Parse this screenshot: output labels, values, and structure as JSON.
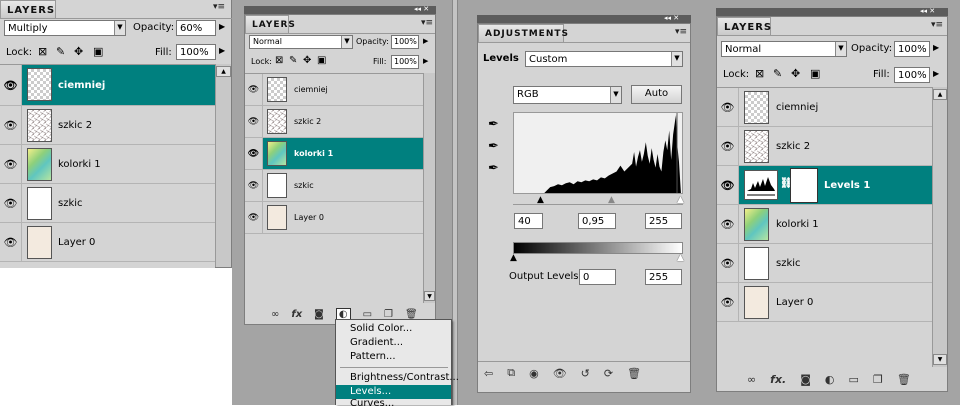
{
  "panel1": {
    "title": "LAYERS",
    "blend_mode": "Multiply",
    "opacity_label": "Opacity:",
    "opacity": "60%",
    "lock_label": "Lock:",
    "fill_label": "Fill:",
    "fill": "100%",
    "layers": [
      {
        "name": "ciemniej",
        "selected": true,
        "thumb": "checker"
      },
      {
        "name": "szkic 2",
        "selected": false,
        "thumb": "sketch"
      },
      {
        "name": "kolorki 1",
        "selected": false,
        "thumb": "color"
      },
      {
        "name": "szkic",
        "selected": false,
        "thumb": "white"
      },
      {
        "name": "Layer 0",
        "selected": false,
        "thumb": "cream"
      }
    ]
  },
  "panel2": {
    "title": "LAYERS",
    "blend_mode": "Normal",
    "opacity_label": "Opacity:",
    "opacity": "100%",
    "lock_label": "Lock:",
    "fill_label": "Fill:",
    "fill": "100%",
    "layers": [
      {
        "name": "ciemniej",
        "selected": false
      },
      {
        "name": "szkic 2",
        "selected": false
      },
      {
        "name": "kolorki 1",
        "selected": true
      },
      {
        "name": "szkic",
        "selected": false
      },
      {
        "name": "Layer 0",
        "selected": false
      }
    ],
    "footer_icons": [
      "link-icon",
      "fx-icon",
      "mask-icon",
      "adjustment-icon",
      "group-icon",
      "new-layer-icon",
      "trash-icon"
    ]
  },
  "popup": {
    "items": [
      "Solid Color...",
      "Gradient...",
      "Pattern...",
      "Brightness/Contrast...",
      "Levels...",
      "Curves..."
    ],
    "highlighted": "Levels..."
  },
  "adjustments": {
    "title": "ADJUSTMENTS",
    "levels_label": "Levels",
    "preset": "Custom",
    "channel": "RGB",
    "auto_label": "Auto",
    "input_black": "40",
    "input_gamma": "0,95",
    "input_white": "255",
    "output_label": "Output Levels:",
    "output_black": "0",
    "output_white": "255"
  },
  "panel4": {
    "title": "LAYERS",
    "blend_mode": "Normal",
    "opacity_label": "Opacity:",
    "opacity": "100%",
    "lock_label": "Lock:",
    "fill_label": "Fill:",
    "fill": "100%",
    "layers": [
      {
        "name": "ciemniej",
        "selected": false
      },
      {
        "name": "szkic 2",
        "selected": false
      },
      {
        "name": "Levels 1",
        "selected": true
      },
      {
        "name": "kolorki 1",
        "selected": false
      },
      {
        "name": "szkic",
        "selected": false
      },
      {
        "name": "Layer 0",
        "selected": false
      }
    ]
  }
}
